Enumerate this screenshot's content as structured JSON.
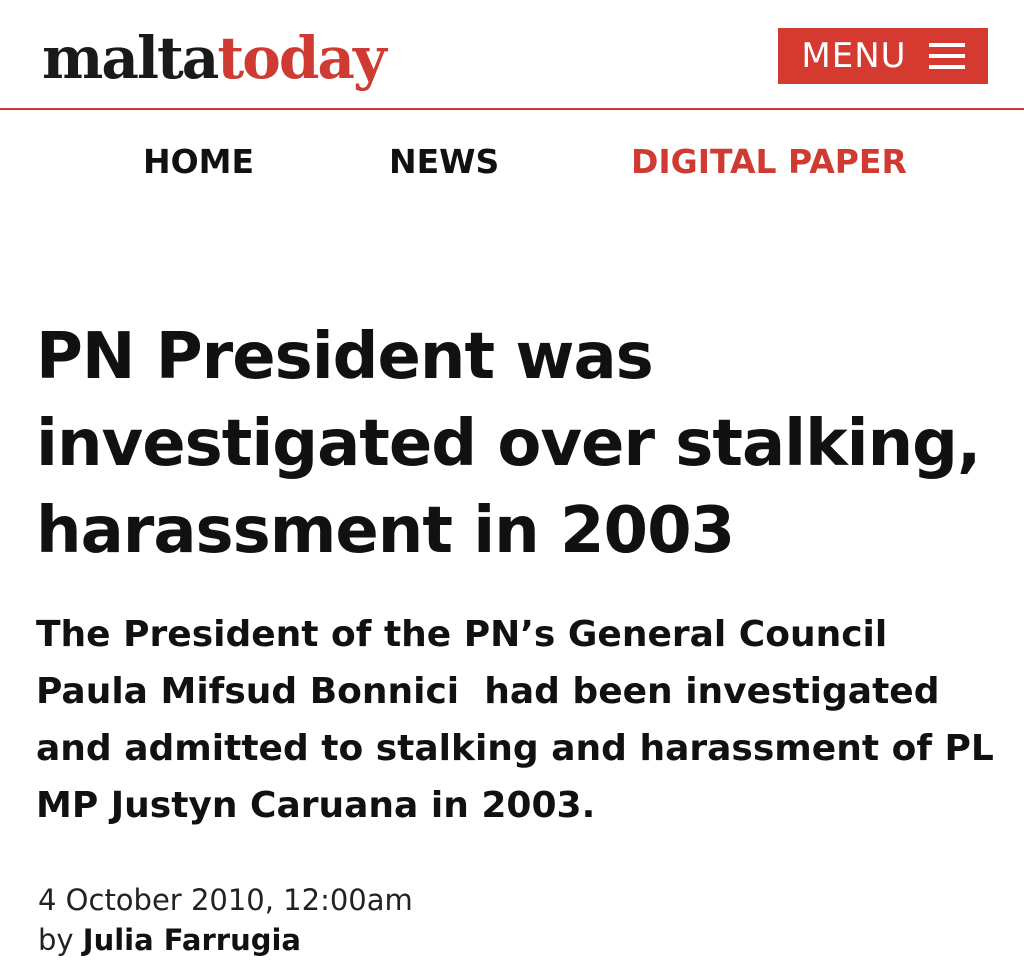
{
  "header": {
    "logo_part1": "malta",
    "logo_part2": "today",
    "menu_label": "MENU"
  },
  "nav": {
    "items": [
      {
        "label": "HOME"
      },
      {
        "label": "NEWS"
      },
      {
        "label": "DIGITAL PAPER"
      }
    ]
  },
  "article": {
    "headline": "PN President was investigated over stalking, harassment in 2003",
    "summary": "The President of the PN’s General Council Paula Mifsud Bonnici  had been investigated and admitted to stalking and harassment of PL MP Justyn Caruana in 2003.",
    "date": "4 October 2010, 12:00am",
    "by_prefix": "by",
    "author": "Julia Farrugia"
  },
  "colors": {
    "accent": "#cf3a32",
    "text": "#111111",
    "background": "#ffffff"
  },
  "icons": {
    "menu": "hamburger-icon"
  }
}
